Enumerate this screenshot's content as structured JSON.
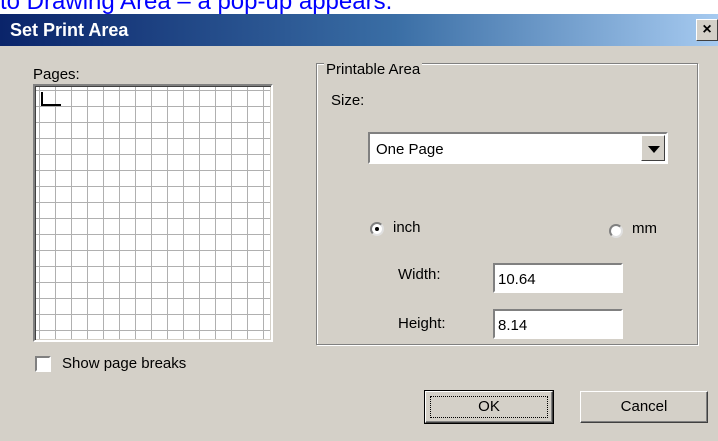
{
  "caption": "to Drawing Area – a pop-up appears.",
  "dialog": {
    "title": "Set Print Area",
    "close_glyph": "×"
  },
  "pages": {
    "label": "Pages:",
    "show_breaks_label": "Show page breaks",
    "show_breaks_checked": false
  },
  "printable_area": {
    "legend": "Printable Area",
    "size_label": "Size:",
    "size_value": "One Page",
    "unit_inch_label": "inch",
    "unit_mm_label": "mm",
    "selected_unit": "inch",
    "width_label": "Width:",
    "width_value": "10.64",
    "height_label": "Height:",
    "height_value": "8.14"
  },
  "buttons": {
    "ok": "OK",
    "cancel": "Cancel"
  }
}
